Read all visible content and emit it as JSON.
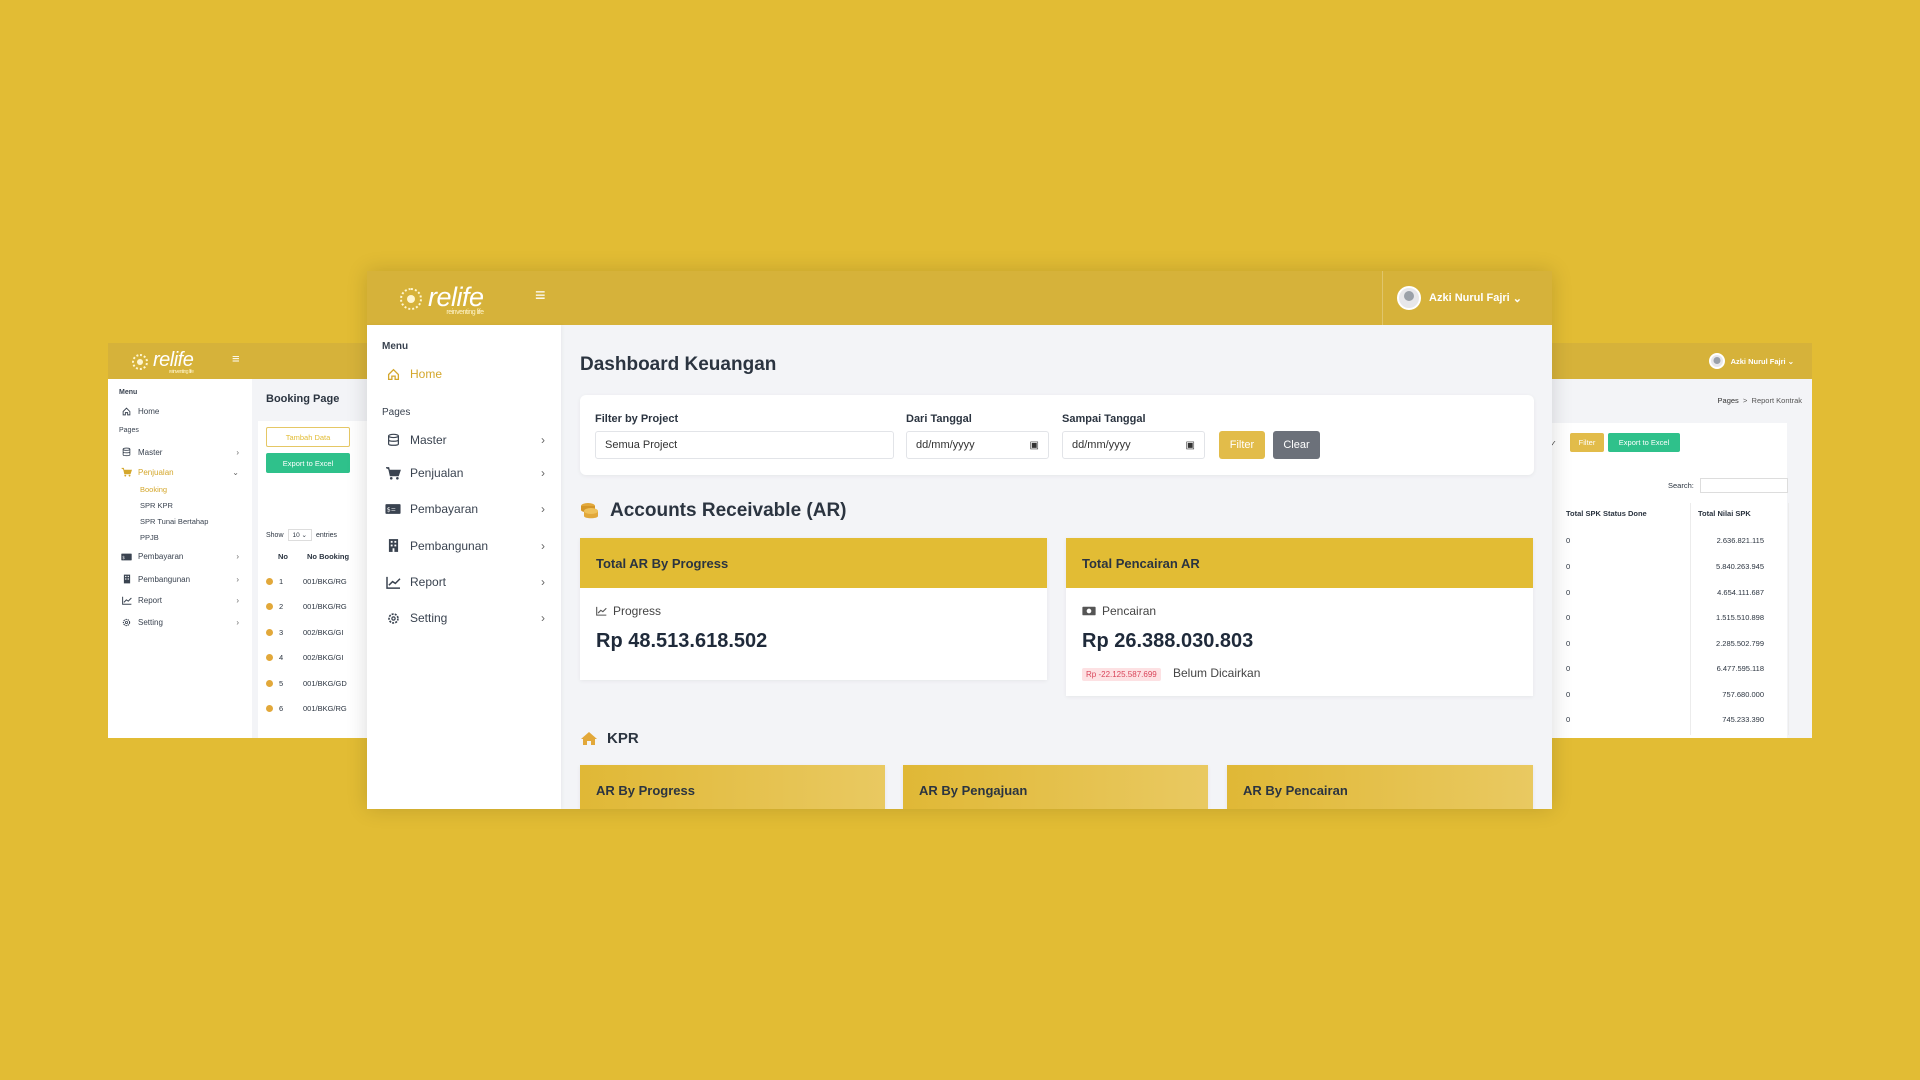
{
  "brand": {
    "logo_text": "relife",
    "logo_sub": "reinventing life"
  },
  "main": {
    "user_name": "Azki Nurul Fajri",
    "menu": {
      "section_menu": "Menu",
      "home": "Home",
      "section_pages": "Pages",
      "items": [
        {
          "label": "Master"
        },
        {
          "label": "Penjualan"
        },
        {
          "label": "Pembayaran"
        },
        {
          "label": "Pembangunan"
        },
        {
          "label": "Report"
        },
        {
          "label": "Setting"
        }
      ]
    },
    "page_title": "Dashboard Keuangan",
    "filter": {
      "project_label": "Filter by Project",
      "project_value": "Semua Project",
      "from_label": "Dari Tanggal",
      "from_placeholder": "dd/mm/yyyy",
      "to_label": "Sampai Tanggal",
      "to_placeholder": "dd/mm/yyyy",
      "filter_button": "Filter",
      "clear_button": "Clear"
    },
    "ar": {
      "title": "Accounts Receivable (AR)",
      "progress_card": {
        "header": "Total AR By Progress",
        "sublabel": "Progress",
        "amount": "Rp 48.513.618.502"
      },
      "pencairan_card": {
        "header": "Total Pencairan AR",
        "sublabel": "Pencairan",
        "amount": "Rp 26.388.030.803",
        "badge": "Rp -22.125.587.699",
        "note": "Belum Dicairkan"
      }
    },
    "kpr": {
      "title": "KPR",
      "cards": [
        "AR By Progress",
        "AR By Pengajuan",
        "AR By Pencairan"
      ]
    }
  },
  "left_window": {
    "menu": {
      "section_menu": "Menu",
      "home": "Home",
      "section_pages": "Pages",
      "master": "Master",
      "penjualan": "Penjualan",
      "sub_items": [
        "Booking",
        "SPR KPR",
        "SPR Tunai Bertahap",
        "PPJB"
      ],
      "pembayaran": "Pembayaran",
      "pembangunan": "Pembangunan",
      "report": "Report",
      "setting": "Setting"
    },
    "page_title": "Booking Page",
    "tambah_button": "Tambah Data",
    "export_button": "Export to Excel",
    "show_label": "Show",
    "show_value": "10",
    "entries_label": "entries",
    "columns": [
      "No",
      "No Booking"
    ],
    "rows": [
      {
        "no": "1",
        "booking": "001/BKG/RG"
      },
      {
        "no": "2",
        "booking": "001/BKG/RG"
      },
      {
        "no": "3",
        "booking": "002/BKG/GI"
      },
      {
        "no": "4",
        "booking": "002/BKG/GI"
      },
      {
        "no": "5",
        "booking": "001/BKG/GD"
      },
      {
        "no": "6",
        "booking": "001/BKG/RG"
      }
    ]
  },
  "right_window": {
    "user_name": "Azki Nurul Fajri",
    "breadcrumb": {
      "pages": "Pages",
      "sep": ">",
      "current": "Report Kontrak"
    },
    "filter_button": "Filter",
    "export_button": "Export to Excel",
    "search_label": "Search:",
    "columns": [
      "Total SPK Status Done",
      "Total Nilai SPK"
    ],
    "rows": [
      {
        "done": "0",
        "nilai": "2.636.821.115"
      },
      {
        "done": "0",
        "nilai": "5.840.263.945"
      },
      {
        "done": "0",
        "nilai": "4.654.111.687"
      },
      {
        "done": "0",
        "nilai": "1.515.510.898"
      },
      {
        "done": "0",
        "nilai": "2.285.502.799"
      },
      {
        "done": "0",
        "nilai": "6.477.595.118"
      },
      {
        "done": "0",
        "nilai": "757.680.000"
      },
      {
        "done": "0",
        "nilai": "745.233.390"
      }
    ]
  },
  "colors": {
    "background": "#e2bc34",
    "topbar": "#d6b23a",
    "accent": "#e2bc34",
    "success": "#2fc18b",
    "danger_badge": "#d9455a"
  },
  "icons": {
    "home": "home-icon",
    "master": "database-icon",
    "penjualan": "cart-icon",
    "pembayaran": "money-icon",
    "pembangunan": "building-icon",
    "report": "chart-line-icon",
    "setting": "gear-icon",
    "ar": "coins-icon",
    "kpr": "house-icon"
  }
}
